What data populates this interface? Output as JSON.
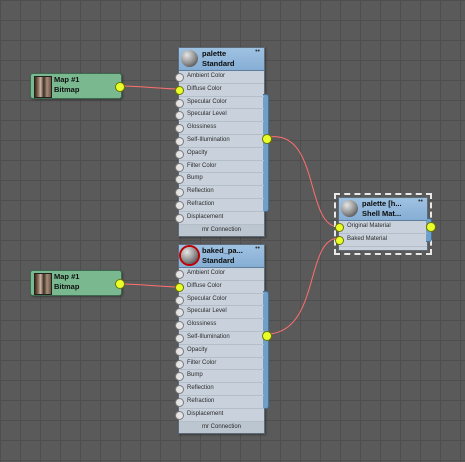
{
  "colors": {
    "background": "#5a5a5a",
    "map_node": "#7ab890",
    "material_header": "#86aed4",
    "active_port": "#e8ff2a",
    "wire": "#ff6f6f"
  },
  "map_nodes": [
    {
      "title": "Map #1",
      "subtitle": "Bitmap"
    },
    {
      "title": "Map #1",
      "subtitle": "Bitmap"
    }
  ],
  "material_nodes": [
    {
      "title": "palette",
      "subtitle": "Standard",
      "collapse": "••",
      "slots": [
        "Ambient Color",
        "Diffuse Color",
        "Specular Color",
        "Specular Level",
        "Glossiness",
        "Self-Illumination",
        "Opacity",
        "Filter Color",
        "Bump",
        "Reflection",
        "Refraction",
        "Displacement"
      ],
      "footer": "mr Connection"
    },
    {
      "title": "baked_pa...",
      "subtitle": "Standard",
      "collapse": "••",
      "slots": [
        "Ambient Color",
        "Diffuse Color",
        "Specular Color",
        "Specular Level",
        "Glossiness",
        "Self-Illumination",
        "Opacity",
        "Filter Color",
        "Bump",
        "Reflection",
        "Refraction",
        "Displacement"
      ],
      "footer": "mr Connection"
    }
  ],
  "shell_node": {
    "title": "palette [h...",
    "subtitle": "Shell Mat...",
    "collapse": "••",
    "slots": [
      "Original Material",
      "Baked Material"
    ]
  }
}
